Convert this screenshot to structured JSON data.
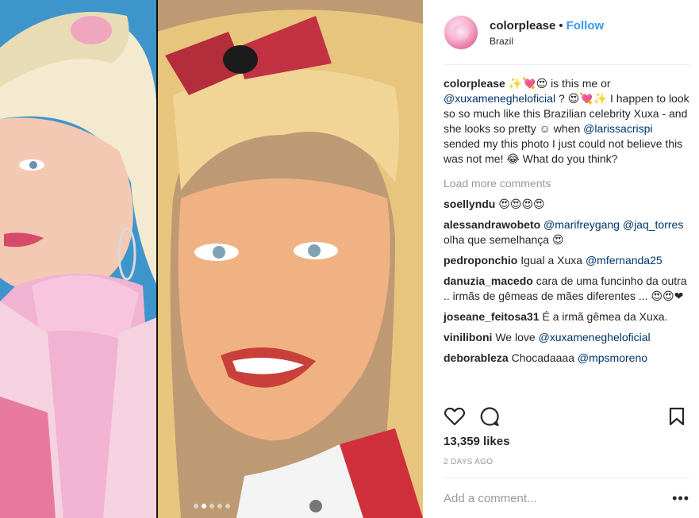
{
  "post": {
    "author": {
      "username": "colorplease",
      "follow_label": "Follow",
      "separator": "•",
      "location": "Brazil"
    },
    "carousel": {
      "slide_count": 5,
      "active_index": 1
    },
    "caption": {
      "username": "colorplease",
      "part1": " ✨💘😍 is this me or ",
      "mention": "@xuxamenegheloficial",
      "part2": " ? 😍💘✨ I happen to look so so much like this Brazilian celebrity Xuxa - and she looks so pretty ☺ when ",
      "mention2": "@larissacrispi",
      "part3": " sended my this photo I just could not believe this was not me! 😂 What do you think?"
    },
    "load_more_label": "Load more comments",
    "comments": [
      {
        "username": "soellyndu",
        "text": " 😍😍😍😍"
      },
      {
        "username": "alessandrawobeto",
        "text": " ",
        "mention": "@marifreygang",
        "text2": " ",
        "mention2": "@jaq_torres",
        "text3": " olha que semelhança 😍"
      },
      {
        "username": "pedroponchio",
        "text": " Igual a Xuxa ",
        "mention": "@mfernanda25"
      },
      {
        "username": "danuzia_macedo",
        "text": " cara de uma funcinho da outra .. irmãs de gêmeas de mães diferentes ... 😍😍❤"
      },
      {
        "username": "joseane_feitosa31",
        "text": " É a irmã gêmea da Xuxa."
      },
      {
        "username": "viniliboni",
        "text": " We love ",
        "mention": "@xuxamenegheloficial"
      },
      {
        "username": "deborableza",
        "text": " Chocadaaaa ",
        "mention": "@mpsmoreno"
      }
    ],
    "likes": "13,359 likes",
    "timestamp": "2 DAYS AGO",
    "add_comment_placeholder": "Add a comment...",
    "more_label": "•••"
  },
  "colors": {
    "link": "#003569",
    "follow": "#3897f0",
    "muted": "#999999",
    "text": "#262626"
  },
  "icons": [
    "heart-icon",
    "comment-icon",
    "bookmark-icon",
    "more-options-icon"
  ]
}
